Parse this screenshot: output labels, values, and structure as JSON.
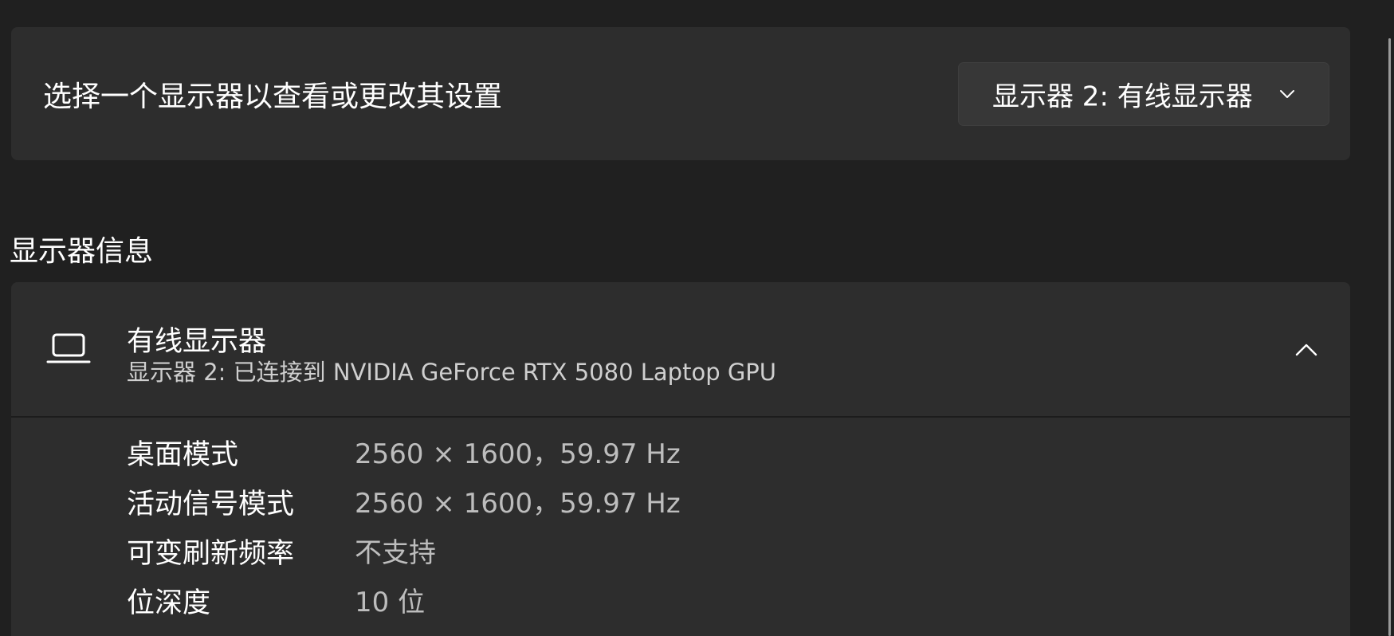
{
  "display_select": {
    "title": "选择一个显示器以查看或更改其设置",
    "selected": "显示器 2: 有线显示器"
  },
  "section": {
    "title": "显示器信息"
  },
  "info_card": {
    "device_name": "有线显示器",
    "device_subtitle": "显示器 2: 已连接到 NVIDIA GeForce RTX 5080 Laptop GPU",
    "rows": [
      {
        "label": "桌面模式",
        "value": "2560 × 1600，59.97 Hz"
      },
      {
        "label": "活动信号模式",
        "value": "2560 × 1600，59.97 Hz"
      },
      {
        "label": "可变刷新频率",
        "value": "不支持"
      },
      {
        "label": "位深度",
        "value": "10 位"
      }
    ]
  },
  "icons": {
    "device": "laptop-icon",
    "dropdown": "chevron-down-icon",
    "collapse": "chevron-up-icon"
  },
  "colors": {
    "background": "#202020",
    "card": "#2d2d2d",
    "dropdown": "#373737",
    "secondary_text": "#bdbdbd"
  }
}
